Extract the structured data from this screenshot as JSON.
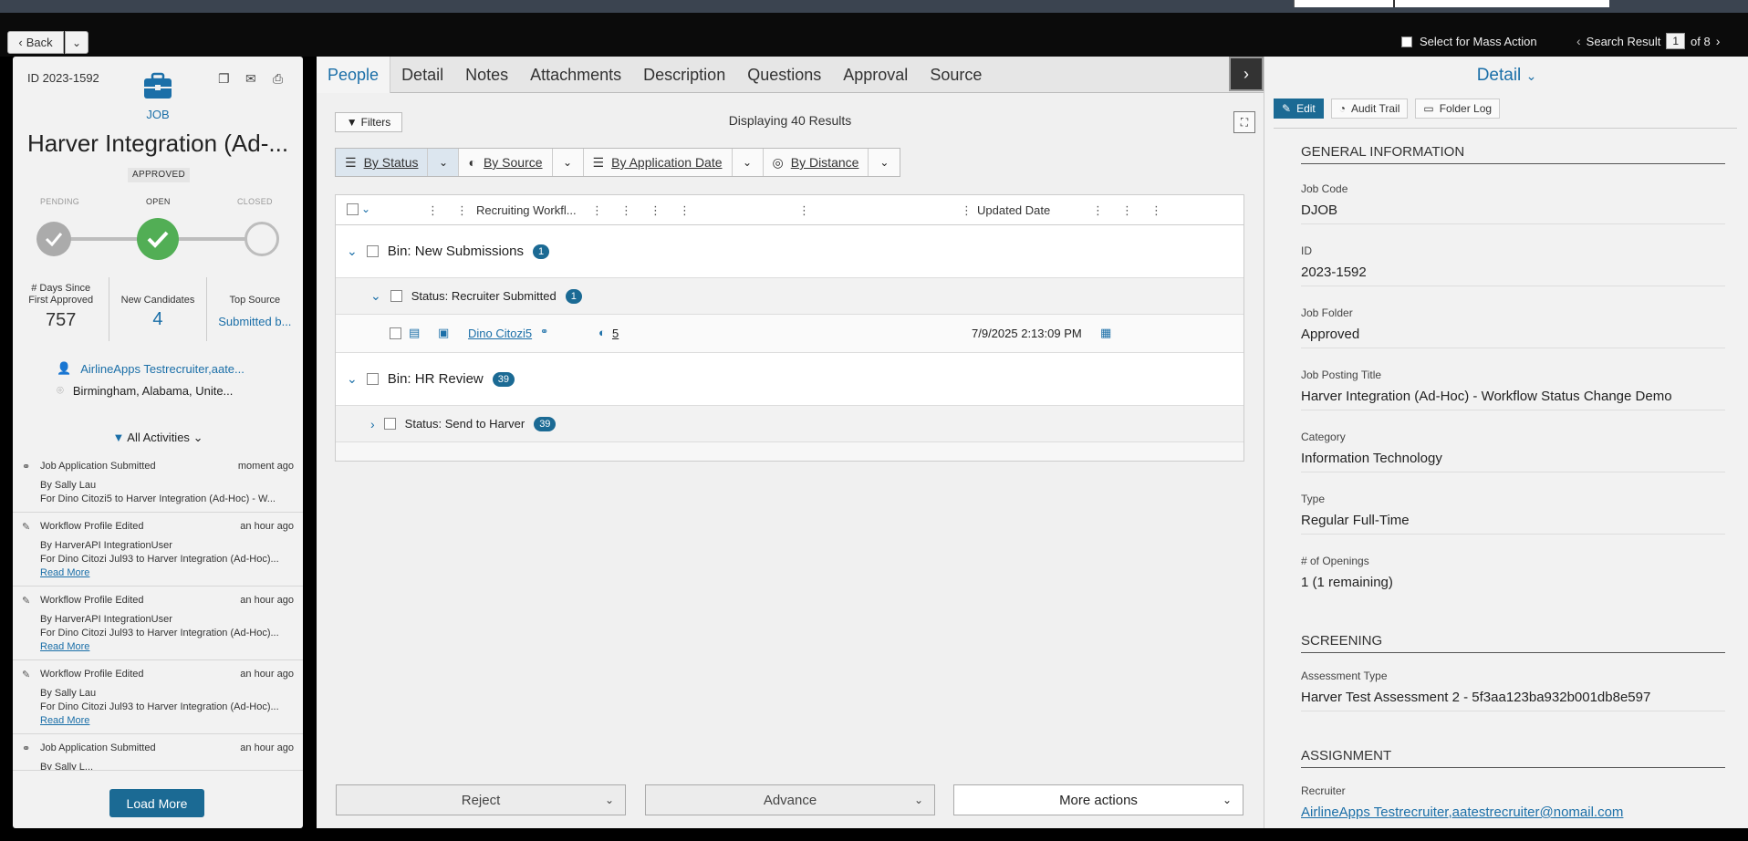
{
  "topbar": {
    "back_label": "Back",
    "mass_action_label": "Select for Mass Action",
    "search_result_label": "Search Result",
    "search_result_page": "1",
    "search_result_total": "of 8"
  },
  "job": {
    "id": "ID 2023-1592",
    "type_label": "JOB",
    "title": "Harver Integration (Ad-...",
    "status_badge": "APPROVED",
    "stages": {
      "pending": "PENDING",
      "open": "OPEN",
      "closed": "CLOSED"
    },
    "stats": [
      {
        "label": "# Days Since First Approved",
        "value": "757"
      },
      {
        "label": "New Candidates",
        "value": "4"
      },
      {
        "label": "Top Source",
        "value": "Submitted b..."
      }
    ],
    "recruiter": "AirlineApps Testrecruiter,aate...",
    "location": "Birmingham, Alabama, Unite..."
  },
  "activities": {
    "filter_label": "All Activities",
    "load_more": "Load More",
    "items": [
      {
        "title": "Job Application Submitted",
        "time": "moment ago",
        "by": "By Sally Lau",
        "for": "For Dino Citozi5 to Harver Integration (Ad-Hoc) - W...",
        "more": ""
      },
      {
        "title": "Workflow Profile Edited",
        "time": "an hour ago",
        "by": "By HarverAPI IntegrationUser",
        "for": "For Dino Citozi Jul93 to Harver Integration (Ad-Hoc)...",
        "more": "Read More"
      },
      {
        "title": "Workflow Profile Edited",
        "time": "an hour ago",
        "by": "By HarverAPI IntegrationUser",
        "for": "For Dino Citozi Jul93 to Harver Integration (Ad-Hoc)...",
        "more": "Read More"
      },
      {
        "title": "Workflow Profile Edited",
        "time": "an hour ago",
        "by": "By Sally Lau",
        "for": "For Dino Citozi Jul93 to Harver Integration (Ad-Hoc)...",
        "more": "Read More"
      },
      {
        "title": "Job Application Submitted",
        "time": "an hour ago",
        "by": "By Sally L...",
        "for": "",
        "more": ""
      }
    ]
  },
  "tabs": [
    "People",
    "Detail",
    "Notes",
    "Attachments",
    "Description",
    "Questions",
    "Approval",
    "Source"
  ],
  "people": {
    "filters_label": "Filters",
    "displaying": "Displaying 40 Results",
    "group_by": [
      "By Status",
      "By Source",
      "By Application Date",
      "By Distance"
    ],
    "columns": {
      "workflow": "Recruiting Workfl...",
      "updated": "Updated Date"
    },
    "bins": [
      {
        "label": "Bin: New Submissions",
        "count": "1",
        "status": "Status: Recruiter Submitted",
        "status_count": "1"
      },
      {
        "label": "Bin: HR Review",
        "count": "39",
        "status": "Status: Send to Harver",
        "status_count": "39"
      }
    ],
    "row": {
      "name": "Dino Citozi5",
      "workflow": "5",
      "updated": "7/9/2025 2:13:09 PM"
    },
    "actions": {
      "reject": "Reject",
      "advance": "Advance",
      "more": "More actions"
    }
  },
  "detail": {
    "title": "Detail",
    "edit": "Edit",
    "audit": "Audit Trail",
    "folder_log": "Folder Log",
    "general": "GENERAL INFORMATION",
    "fields": [
      {
        "label": "Job Code",
        "value": "DJOB"
      },
      {
        "label": "ID",
        "value": "2023-1592"
      },
      {
        "label": "Job Folder",
        "value": "Approved"
      },
      {
        "label": "Job Posting Title",
        "value": "Harver Integration (Ad-Hoc) - Workflow Status Change Demo"
      },
      {
        "label": "Category",
        "value": "Information Technology"
      },
      {
        "label": "Type",
        "value": "Regular Full-Time"
      },
      {
        "label": "# of Openings",
        "value": "1 (1 remaining)"
      }
    ],
    "screening": "SCREENING",
    "assessment_label": "Assessment Type",
    "assessment_value": "Harver Test Assessment 2 - 5f3aa123ba932b001db8e597",
    "assignment": "ASSIGNMENT",
    "recruiter_label": "Recruiter",
    "recruiter_value": "AirlineApps Testrecruiter,aatestrecruiter@nomail.com"
  },
  "colors": {
    "accent": "#1b6fa8",
    "button": "#1b6a94",
    "open": "#52ae55"
  }
}
